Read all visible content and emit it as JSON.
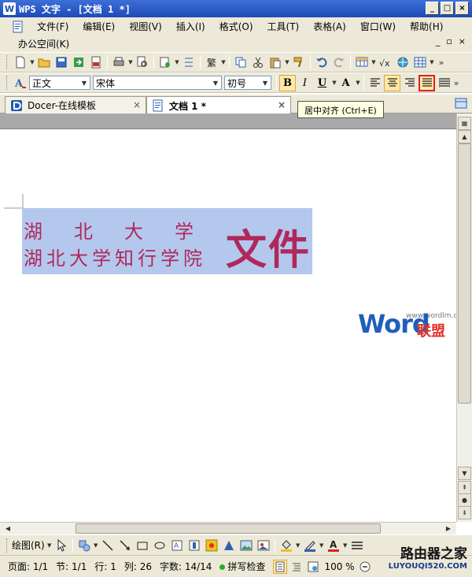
{
  "titlebar": {
    "app_icon": "W",
    "title": "WPS 文字 - [文档 1 *]",
    "min": "_",
    "max": "□",
    "close": "×"
  },
  "menu": {
    "items": [
      "文件(F)",
      "编辑(E)",
      "视图(V)",
      "插入(I)",
      "格式(O)",
      "工具(T)",
      "表格(A)",
      "窗口(W)",
      "帮助(H)"
    ],
    "office_space": "办公空间(K)",
    "mdi_min": "_",
    "mdi_restore": "▫",
    "mdi_close": "×"
  },
  "format": {
    "style": "正文",
    "font": "宋体",
    "size": "初号",
    "bold": "B",
    "italic": "I",
    "underline": "U",
    "char_border": "A"
  },
  "tabs": [
    {
      "label": "Docer-在线模板",
      "close": "×"
    },
    {
      "label": "文档 1 *",
      "close": "×"
    }
  ],
  "tooltip": "居中对齐 (Ctrl+E)",
  "document": {
    "line1": "湖北大学",
    "line2": "湖北大学知行学院",
    "big": "文件",
    "text_color": "#b0285a",
    "selection_color": "#b4c8ee"
  },
  "watermark": {
    "url": "www.wordlm.com",
    "word": "Word",
    "lm": "联盟"
  },
  "drawbar": {
    "label": "绘图(R)"
  },
  "status": {
    "page": "页面: 1/1",
    "section": "节: 1/1",
    "row": "行: 1",
    "col": "列: 26",
    "chars": "字数: 14/14",
    "spell": "拼写检查",
    "zoom": "100 %"
  },
  "watermark2": {
    "a": "路由器之家",
    "b": "LUYOUQI520.COM"
  }
}
